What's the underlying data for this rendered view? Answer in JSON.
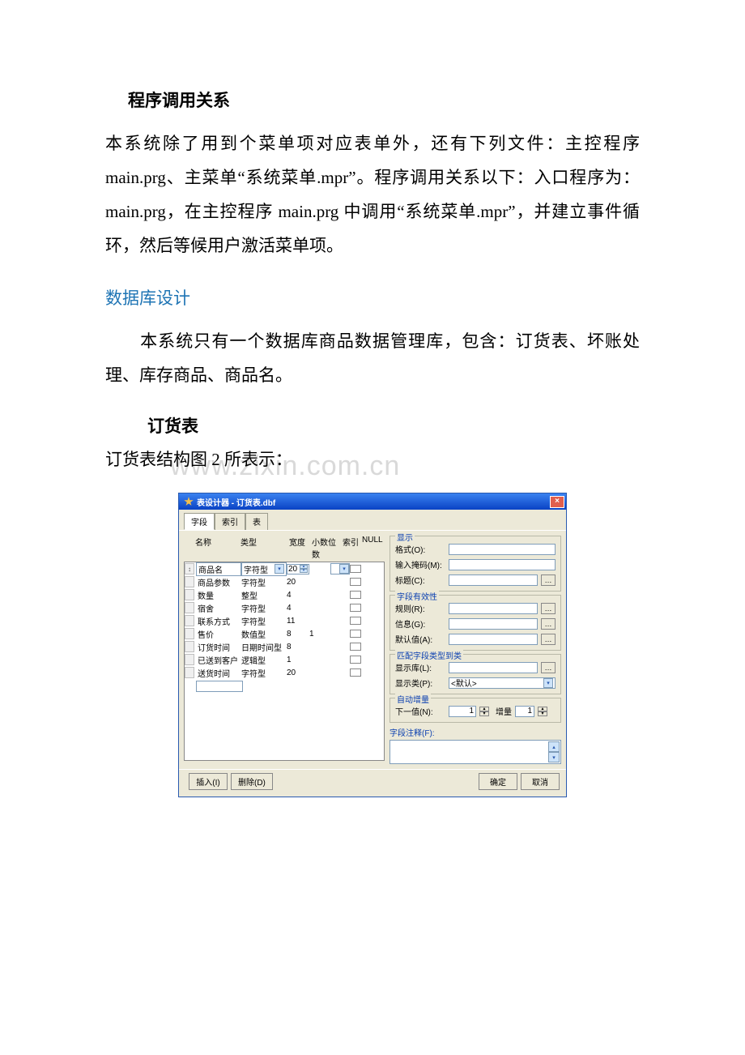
{
  "doc": {
    "heading1": "程序调用关系",
    "para1": "本系统除了用到个菜单项对应表单外，还有下列文件：主控程序 main.prg、主菜单“系统菜单.mpr”。程序调用关系以下：入口程序为：main.prg，在主控程序 main.prg 中调用“系统菜单.mpr”，并建立事件循环，然后等候用户激活菜单项。",
    "heading2": "数据库设计",
    "para2": "本系统只有一个数据库商品数据管理库，包含：订货表、坏账处理、库存商品、商品名。",
    "heading3": "订货表",
    "para3": "订货表结构图 2 所表示：",
    "watermark": "www.zixin.com.cn"
  },
  "designer": {
    "title": "表设计器 - 订货表.dbf",
    "tabs": [
      "字段",
      "索引",
      "表"
    ],
    "columns": {
      "name": "名称",
      "type": "类型",
      "width": "宽度",
      "decimals": "小数位数",
      "index": "索引",
      "null": "NULL"
    },
    "rows": [
      {
        "name": "商品名",
        "type": "字符型",
        "width": "20",
        "dec": "",
        "selected": true
      },
      {
        "name": "商品参数",
        "type": "字符型",
        "width": "20",
        "dec": ""
      },
      {
        "name": "数量",
        "type": "整型",
        "width": "4",
        "dec": ""
      },
      {
        "name": "宿舍",
        "type": "字符型",
        "width": "4",
        "dec": ""
      },
      {
        "name": "联系方式",
        "type": "字符型",
        "width": "11",
        "dec": ""
      },
      {
        "name": "售价",
        "type": "数值型",
        "width": "8",
        "dec": "1"
      },
      {
        "name": "订货时间",
        "type": "日期时间型",
        "width": "8",
        "dec": ""
      },
      {
        "name": "已送到客户",
        "type": "逻辑型",
        "width": "1",
        "dec": ""
      },
      {
        "name": "送货时间",
        "type": "字符型",
        "width": "20",
        "dec": ""
      }
    ],
    "groups": {
      "display": {
        "title": "显示",
        "format": "格式(O):",
        "mask": "输入掩码(M):",
        "caption": "标题(C):"
      },
      "validation": {
        "title": "字段有效性",
        "rule": "规则(R):",
        "info": "信息(G):",
        "default": "默认值(A):"
      },
      "mapping": {
        "title": "匹配字段类型到类",
        "display_lib": "显示库(L):",
        "display_class": "显示类(P):",
        "display_class_value": "<默认>"
      },
      "autoinc": {
        "title": "自动增量",
        "next": "下一值(N):",
        "next_value": "1",
        "step": "增量",
        "step_value": "1"
      },
      "comment": {
        "title": "字段注释(F):"
      }
    },
    "buttons": {
      "insert": "插入(I)",
      "delete": "删除(D)",
      "ok": "确定",
      "cancel": "取消"
    }
  }
}
